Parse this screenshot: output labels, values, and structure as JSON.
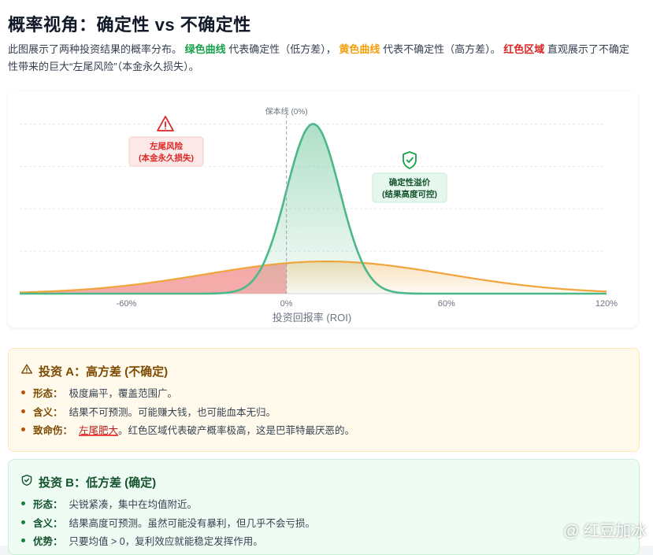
{
  "header": {
    "title": "概率视角：确定性 vs 不确定性",
    "intro_1": "此图展示了两种投资结果的概率分布。",
    "green_label": "绿色曲线",
    "intro_2": "代表确定性（低方差），",
    "yellow_label": "黄色曲线",
    "intro_3": "代表不确定性（高方差）。",
    "red_label": "红色区域",
    "intro_4": "直观展示了不确定性带来的巨大“左尾风险”（本金永久损失）。"
  },
  "colors": {
    "green": "#4cb88a",
    "orange": "#f0a53a",
    "red_fill": "#f3a3a3",
    "green_fill_top": "#6cc59a"
  },
  "chart_data": {
    "type": "area",
    "title": "",
    "xlabel": "投资回报率 (ROI)",
    "ylabel": "",
    "xlim": [
      -100,
      120
    ],
    "ylim": [
      0,
      1.1
    ],
    "x_ticks": [
      "-60%",
      "0%",
      "60%",
      "120%"
    ],
    "grid": true,
    "series": [
      {
        "name": "绿色曲线",
        "mean": 10,
        "std": 10,
        "peak": 1.0
      },
      {
        "name": "黄色曲线",
        "mean": 15,
        "std": 45,
        "peak": 0.19
      }
    ],
    "shaded_region": {
      "series": "黄色曲线",
      "x_from": -100,
      "x_to": 0
    },
    "reference_line": {
      "x": 0,
      "label": "保本线 (0%)"
    },
    "annotations": [
      {
        "label": "左尾风险",
        "sub": "(本金永久损失)",
        "icon": "warning-icon"
      },
      {
        "label": "确定性溢价",
        "sub": "(结果高度可控)",
        "icon": "shield-check-icon"
      }
    ]
  },
  "invest_a": {
    "title": "投资 A：高方差 (不确定)",
    "items": [
      {
        "k": "形态：",
        "v": "极度扁平，覆盖范围广。"
      },
      {
        "k": "含义：",
        "v": "结果不可预测。可能赚大钱，也可能血本无归。"
      },
      {
        "k": "致命伤：",
        "hl": "左尾肥大",
        "v": "。红色区域代表破产概率极高，这是巴菲特最厌恶的。"
      }
    ]
  },
  "invest_b": {
    "title": "投资 B：低方差 (确定)",
    "items": [
      {
        "k": "形态：",
        "v": "尖锐紧凑，集中在均值附近。"
      },
      {
        "k": "含义：",
        "v": "结果高度可预测。虽然可能没有暴利，但几乎不会亏损。"
      },
      {
        "k": "优势：",
        "v": "只要均值 > 0，复利效应就能稳定发挥作用。"
      }
    ]
  },
  "watermark": "@ 红豆加冰"
}
